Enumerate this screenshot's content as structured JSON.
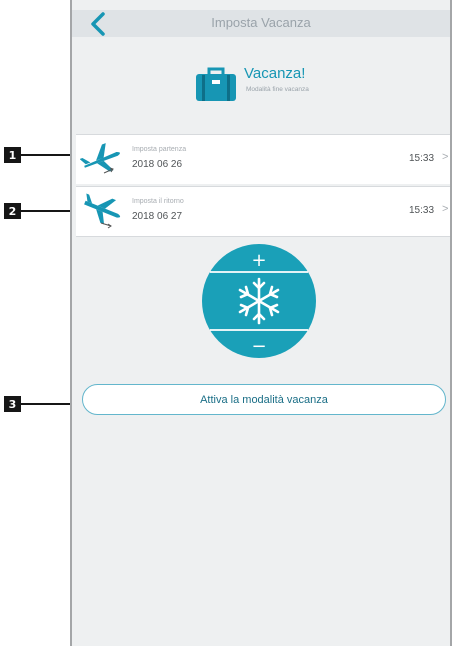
{
  "topbar": {
    "title": "Imposta Vacanza",
    "back_icon": "chevron-left-icon"
  },
  "hero": {
    "title": "Vacanza!",
    "subtitle": "Modalità fine vacanza",
    "icon": "suitcase-icon"
  },
  "rows": [
    {
      "label": "Imposta partenza",
      "date": "2018 06 26",
      "time": "15:33",
      "arrow": ">",
      "icon": "plane-departure-icon"
    },
    {
      "label": "Imposta il ritorno",
      "date": "2018 06 27",
      "time": "15:33",
      "arrow": ">",
      "icon": "plane-arrival-icon"
    }
  ],
  "dial": {
    "plus": "+",
    "minus": "−",
    "icon": "snowflake-icon"
  },
  "activate_button": {
    "label": "Attiva la modalità vacanza"
  },
  "callouts": [
    "1",
    "2",
    "3"
  ],
  "colors": {
    "accent": "#1796b4",
    "dial": "#1aa0b8",
    "background": "#eef0f1"
  }
}
